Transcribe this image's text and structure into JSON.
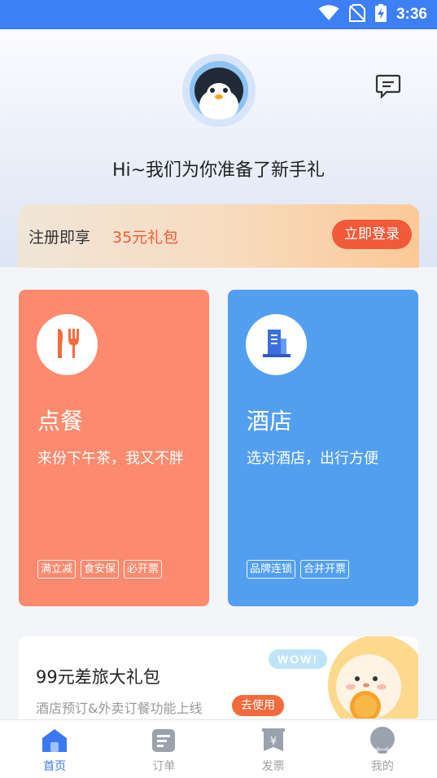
{
  "status_bar": {
    "time": "3:36",
    "icons": [
      "wifi-icon",
      "no-sim-icon",
      "battery-charging-icon"
    ]
  },
  "header": {
    "avatar_icon": "penguin-avatar-icon",
    "message_icon": "message-icon",
    "welcome_text": "Hi~我们为你准备了新手礼"
  },
  "promo": {
    "label": "注册即享",
    "amount": "35元礼包",
    "login_button": "立即登录"
  },
  "services": [
    {
      "title": "点餐",
      "subtitle": "来份下午茶，我又不胖",
      "icon": "fork-knife-icon",
      "color": "#fc8a6e",
      "tags": [
        "满立减",
        "食安保",
        "必开票"
      ]
    },
    {
      "title": "酒店",
      "subtitle": "选对酒店，出行方便",
      "icon": "hotel-building-icon",
      "color": "#529ff0",
      "tags": [
        "品牌连锁",
        "合并开票"
      ]
    }
  ],
  "banner": {
    "title": "99元差旅大礼包",
    "subtitle": "酒店预订&外卖订餐功能上线",
    "button": "去使用",
    "badge": "WOW!"
  },
  "tabbar": {
    "active_color": "#3a78f1",
    "items": [
      {
        "label": "首页",
        "icon": "home-icon",
        "active": true
      },
      {
        "label": "订单",
        "icon": "order-list-icon",
        "active": false
      },
      {
        "label": "发票",
        "icon": "invoice-icon",
        "active": false
      },
      {
        "label": "我的",
        "icon": "profile-icon",
        "active": false
      }
    ]
  }
}
